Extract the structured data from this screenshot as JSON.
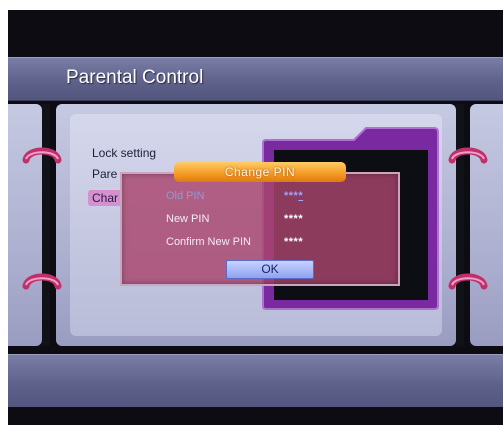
{
  "header": {
    "title": "Parental Control"
  },
  "menu": {
    "items": [
      {
        "label": "Lock setting"
      },
      {
        "label": "Pare"
      },
      {
        "label": "Char"
      }
    ]
  },
  "dialog": {
    "title": "Change PIN",
    "rows": [
      {
        "label": "Old PIN",
        "value": "***"
      },
      {
        "label": "New PIN",
        "value": "****"
      },
      {
        "label": "Confirm New PIN",
        "value": "****"
      }
    ],
    "ok_label": "OK"
  },
  "colors": {
    "title_bar": "#5d6089",
    "dialog_bg": "#aa466e",
    "dialog_header": "#f39a24",
    "ok_button": "#8fa2f2",
    "selected_item": "#d490cf",
    "folder": "#7a2aa0"
  },
  "icons": [
    "hook-icon",
    "folder-icon"
  ]
}
